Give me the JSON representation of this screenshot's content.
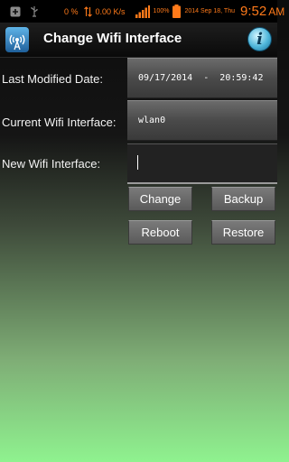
{
  "status_bar": {
    "signal_percent": "0 %",
    "network_speed": "0.00 K/s",
    "battery_percent": "100%",
    "date": "2014 Sep 18, Thu",
    "time": "9:52",
    "meridiem": "AM",
    "accent_color": "#ff7a1a",
    "icons": [
      "plus-icon",
      "usb-icon",
      "network-arrows-icon",
      "signal-bars-icon",
      "battery-icon"
    ]
  },
  "header": {
    "title": "Change Wifi Interface",
    "app_icon": "wifi-tower-icon",
    "info_icon": "info-icon",
    "info_glyph": "i"
  },
  "form": {
    "last_modified_label": "Last Modified Date:",
    "last_modified_value": "09/17/2014  -  20:59:42",
    "current_interface_label": "Current Wifi Interface:",
    "current_interface_value": "wlan0",
    "new_interface_label": "New Wifi Interface:",
    "new_interface_value": ""
  },
  "buttons": {
    "change": "Change",
    "backup": "Backup",
    "reboot": "Reboot",
    "restore": "Restore"
  }
}
